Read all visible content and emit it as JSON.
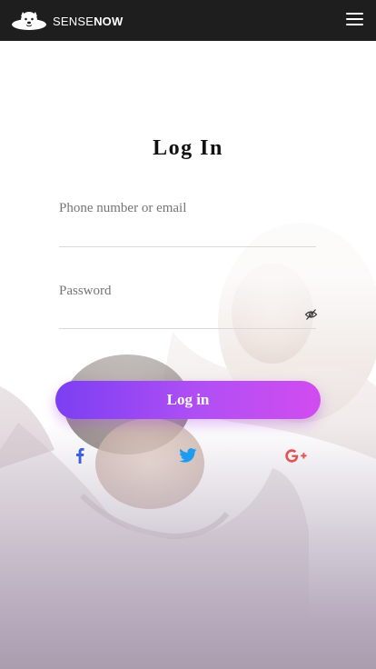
{
  "header": {
    "brand_prefix": "SENSE",
    "brand_suffix": "NOW",
    "menu_icon": "hamburger-menu-icon",
    "background_color": "#1e1e1e"
  },
  "login": {
    "title": "Log In",
    "identifier_placeholder": "Phone number or email",
    "password_placeholder": "Password",
    "submit_label": "Log in",
    "password_toggle_icon": "eye-slash-icon"
  },
  "social": {
    "facebook_icon": "facebook-icon",
    "twitter_icon": "twitter-icon",
    "google_plus_icon": "google-plus-icon",
    "colors": {
      "facebook": "#3b5fe0",
      "twitter": "#1d9bf0",
      "google_plus": "#e05454"
    }
  },
  "colors": {
    "button_start": "#7b3ff2",
    "button_end": "#d14cf0",
    "background_bottom": "#a99dae"
  }
}
